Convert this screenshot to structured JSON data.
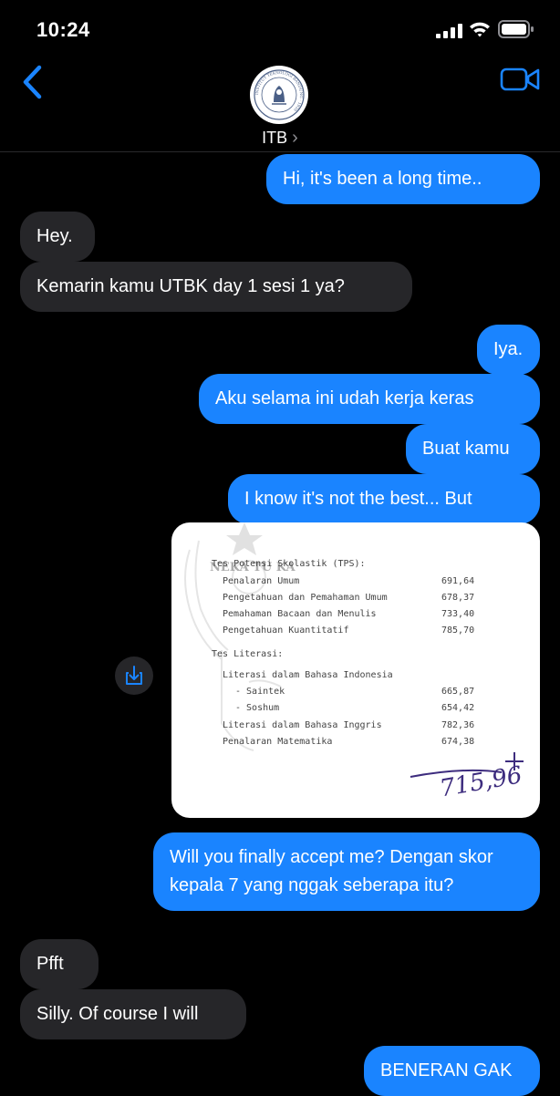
{
  "status": {
    "time": "10:24"
  },
  "header": {
    "contact_name": "ITB",
    "chevron": "›",
    "avatar_text": "INSTITUT TEKNOLOGI BANDUNG · 1920"
  },
  "messages": [
    {
      "sender": "me",
      "text": "Hi, it's been a long time.."
    },
    {
      "sender": "them",
      "text": "Hey."
    },
    {
      "sender": "them",
      "text": "Kemarin kamu UTBK day 1 sesi 1 ya?"
    },
    {
      "sender": "me",
      "text": "Iya."
    },
    {
      "sender": "me",
      "text": "Aku selama ini udah kerja keras"
    },
    {
      "sender": "me",
      "text": "Buat kamu"
    },
    {
      "sender": "me",
      "text": "I know it's not the best... But"
    },
    {
      "sender": "me",
      "text": "Will you finally accept me? Dengan skor kepala 7 yang nggak seberapa itu?"
    },
    {
      "sender": "them",
      "text": "Pfft"
    },
    {
      "sender": "them",
      "text": "Silly. Of course I will"
    },
    {
      "sender": "me",
      "text": "BENERAN GAK"
    }
  ],
  "score_sheet": {
    "tps_heading": "Tes Potensi Skolastik (TPS):",
    "tps_rows": [
      {
        "label": "Penalaran Umum",
        "value": "691,64"
      },
      {
        "label": "Pengetahuan dan Pemahaman Umum",
        "value": "678,37"
      },
      {
        "label": "Pemahaman Bacaan dan Menulis",
        "value": "733,40"
      },
      {
        "label": "Pengetahuan Kuantitatif",
        "value": "785,70"
      }
    ],
    "literasi_heading": "Tes Literasi:",
    "literasi_rows": [
      {
        "label": "Literasi dalam Bahasa Indonesia",
        "value": ""
      },
      {
        "label": "- Saintek",
        "value": "665,87"
      },
      {
        "label": "- Soshum",
        "value": "654,42"
      },
      {
        "label": "Literasi dalam Bahasa Inggris",
        "value": "782,36"
      },
      {
        "label": "Penalaran Matematika",
        "value": "674,38"
      }
    ],
    "handwritten_total": "715,96",
    "watermark_text": "NEKA TU KA"
  },
  "colors": {
    "outgoing": "#1a84ff",
    "incoming": "#262629",
    "accent": "#1a84ff",
    "background": "#000000"
  }
}
